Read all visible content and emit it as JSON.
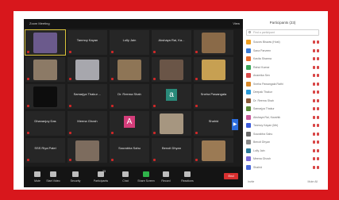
{
  "window": {
    "title": "Zoom Meeting",
    "view_label": "View"
  },
  "grid_tiles": [
    {
      "name": "",
      "photo": "#6b5a8c"
    },
    {
      "name": "Tanmoy Kayan"
    },
    {
      "name": "Lolly Jain"
    },
    {
      "name": "Akshaya Rai, Ka..."
    },
    {
      "name": "",
      "photo": "#8a6a48"
    },
    {
      "name": "",
      "photo": "#8c7a66"
    },
    {
      "name": "",
      "photo": "#a7a7ad"
    },
    {
      "name": "",
      "photo": "#8e7556"
    },
    {
      "name": "",
      "photo": "#6a5547"
    },
    {
      "name": "",
      "photo": "#c7a052"
    },
    {
      "name": "",
      "photo": "#0d0d0d"
    },
    {
      "name": "Samarjya Thakur ..."
    },
    {
      "name": "Dr. Reema Shah"
    },
    {
      "name": "a",
      "avatar_color": "#2a8a7a"
    },
    {
      "name": "Sneha Pawangala"
    },
    {
      "name": "Dhananjoy Das"
    },
    {
      "name": "Meena Ghosh"
    },
    {
      "name": "A",
      "avatar_color": "#d43d7a"
    },
    {
      "name": "",
      "photo": "#a69680"
    },
    {
      "name": "Shahid"
    },
    {
      "name": "SSS Riya Patel"
    },
    {
      "name": "",
      "photo": "#7d6c5e"
    },
    {
      "name": "Sourabha Sahu"
    },
    {
      "name": "Benoit Dhyan"
    },
    {
      "name": "",
      "photo": "#9b7a54"
    }
  ],
  "toolbar": {
    "buttons": [
      {
        "label": "Mute",
        "icon": "mic-icon"
      },
      {
        "label": "Start Video",
        "icon": "video-icon"
      },
      {
        "label": "Security",
        "icon": "shield-icon"
      },
      {
        "label": "Participants",
        "icon": "participants-icon",
        "count": "23"
      },
      {
        "label": "Chat",
        "icon": "chat-icon"
      },
      {
        "label": "Share Screen",
        "icon": "share-screen-icon",
        "accent": "#2fb34a"
      },
      {
        "label": "Record",
        "icon": "record-icon"
      },
      {
        "label": "Reactions",
        "icon": "reactions-icon"
      }
    ],
    "end_label": "End"
  },
  "panel": {
    "title": "Participants (23)",
    "search_placeholder": "Find a participant",
    "participants": [
      {
        "name": "Sourav Biswas (Host)",
        "color": "#f0a020"
      },
      {
        "name": "Sana Parveen",
        "color": "#3a7bd5"
      },
      {
        "name": "Kavita Sharma",
        "color": "#e86a2a"
      },
      {
        "name": "Rahul Kumar",
        "color": "#3aa65a"
      },
      {
        "name": "Anamika Sen",
        "color": "#d94a4a"
      },
      {
        "name": "Sneha Pawangala Rathi",
        "color": "#d98a2a"
      },
      {
        "name": "Deepak Thakur",
        "color": "#2a9ad9"
      },
      {
        "name": "Dr. Reema Shah",
        "color": "#8a5a3a"
      },
      {
        "name": "Samarjya Thakur",
        "color": "#5a8a3a"
      },
      {
        "name": "Akshaya Rai, Kaushik",
        "color": "#c95a9a"
      },
      {
        "name": "Tanmoy Kayan (Me)",
        "color": "#3a5ad9"
      },
      {
        "name": "Sourabha Sahu",
        "color": "#6a6a6a"
      },
      {
        "name": "Benoit Dhyan",
        "color": "#8a8a8a"
      },
      {
        "name": "Lolly Jain",
        "color": "#2a7a9a"
      },
      {
        "name": "Meena Ghosh",
        "color": "#7a6ad9"
      },
      {
        "name": "Shahid",
        "color": "#4a6ad9"
      }
    ],
    "footer_left": "Invite",
    "footer_right": "Mute All"
  },
  "colors": {
    "frame": "#d8171c",
    "mic_muted": "#d02828",
    "selected_border": "#d9c33a",
    "end_button": "#d83030"
  }
}
